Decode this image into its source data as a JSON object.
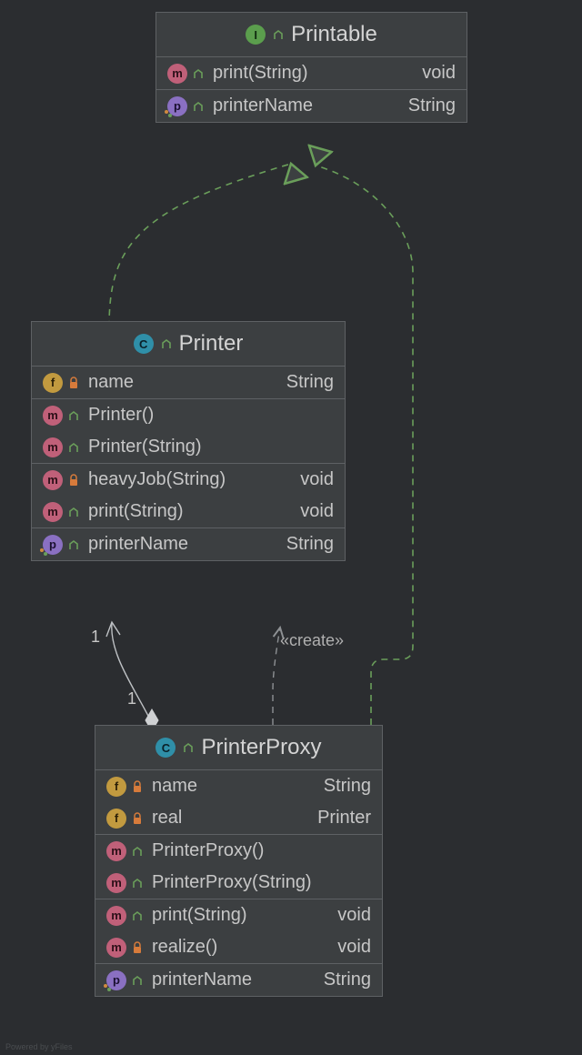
{
  "colors": {
    "background": "#2b2d30",
    "panel": "#3c3f41",
    "border": "#5e6164",
    "text": "#c7c7c7",
    "relationGreen": "#6a9e5a",
    "relationGray": "#8e9194"
  },
  "watermark": "Powered by yFiles",
  "badges": {
    "I": "I",
    "C": "C",
    "m": "m",
    "f": "f",
    "p": "p"
  },
  "relations": {
    "create_label": "«create»",
    "mult_1a": "1",
    "mult_1b": "1"
  },
  "classes": {
    "printable": {
      "kind": "interface",
      "title": "Printable",
      "rows": [
        {
          "badge": "m",
          "vis": "open",
          "name": "print(String)",
          "type": "void"
        },
        {
          "badge": "p",
          "dots": true,
          "vis": "open",
          "name": "printerName",
          "type": "String"
        }
      ]
    },
    "printer": {
      "kind": "class",
      "title": "Printer",
      "rows": [
        {
          "badge": "f",
          "vis": "lock",
          "name": "name",
          "type": "String",
          "divider": false
        },
        {
          "badge": "m",
          "vis": "open",
          "name": "Printer()",
          "type": "",
          "divider": true
        },
        {
          "badge": "m",
          "vis": "open",
          "name": "Printer(String)",
          "type": ""
        },
        {
          "badge": "m",
          "vis": "lock",
          "name": "heavyJob(String)",
          "type": "void",
          "divider": true
        },
        {
          "badge": "m",
          "vis": "open",
          "name": "print(String)",
          "type": "void"
        },
        {
          "badge": "p",
          "dots": true,
          "vis": "open",
          "name": "printerName",
          "type": "String",
          "divider": true
        }
      ]
    },
    "printerProxy": {
      "kind": "class",
      "title": "PrinterProxy",
      "rows": [
        {
          "badge": "f",
          "vis": "lock",
          "name": "name",
          "type": "String"
        },
        {
          "badge": "f",
          "vis": "lock",
          "name": "real",
          "type": "Printer"
        },
        {
          "badge": "m",
          "vis": "open",
          "name": "PrinterProxy()",
          "type": "",
          "divider": true
        },
        {
          "badge": "m",
          "vis": "open",
          "name": "PrinterProxy(String)",
          "type": ""
        },
        {
          "badge": "m",
          "vis": "open",
          "name": "print(String)",
          "type": "void",
          "divider": true
        },
        {
          "badge": "m",
          "vis": "lock",
          "name": "realize()",
          "type": "void"
        },
        {
          "badge": "p",
          "dots": true,
          "vis": "open",
          "name": "printerName",
          "type": "String",
          "divider": true
        }
      ]
    }
  }
}
